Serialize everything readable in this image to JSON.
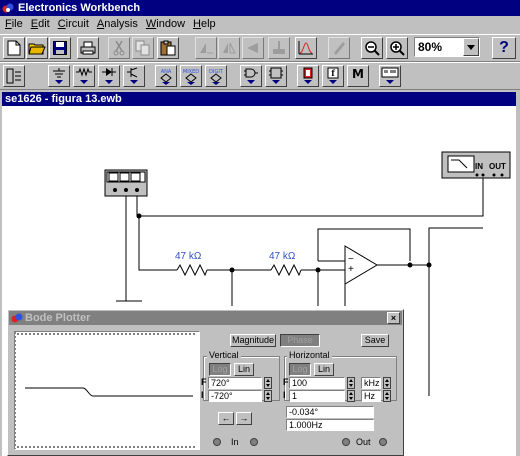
{
  "window": {
    "title": "Electronics Workbench"
  },
  "menu": [
    {
      "label": "File",
      "key": "F",
      "rest": "ile"
    },
    {
      "label": "Edit",
      "key": "E",
      "rest": "dit"
    },
    {
      "label": "Circuit",
      "key": "C",
      "rest": "ircuit"
    },
    {
      "label": "Analysis",
      "key": "A",
      "rest": "nalysis"
    },
    {
      "label": "Window",
      "key": "W",
      "rest": "indow"
    },
    {
      "label": "Help",
      "key": "H",
      "rest": "elp"
    }
  ],
  "toolbar": {
    "zoom_value": "80%",
    "help_label": "?",
    "parts_bin_labels": {
      "analog": "ANA",
      "mixed": "MIXED",
      "digital": "DIGIT"
    },
    "function_label": "f",
    "misc_label": "M"
  },
  "document": {
    "title": "se1626 - figura 13.ewb"
  },
  "circuit": {
    "r1_label": "47 kΩ",
    "r2_label": "47 kΩ",
    "filter_in": "IN",
    "filter_out": "OUT",
    "opamp_minus": "−",
    "opamp_plus": "+"
  },
  "bode": {
    "title": "Bode Plotter",
    "close_label": "×",
    "magnitude_label": "Magnitude",
    "phase_label": "Phase",
    "save_label": "Save",
    "vertical_label": "Vertical",
    "horizontal_label": "Horizontal",
    "log_label": "Log",
    "lin_label": "Lin",
    "v_final_value": "720°",
    "v_initial_value": "-720°",
    "h_final_value": "100",
    "h_final_unit": "kHz",
    "h_initial_value": "1",
    "h_initial_unit": "Hz",
    "f_label": "F",
    "i_label": "I",
    "left_arrow": "←",
    "right_arrow": "→",
    "readout_phase": "-0.034°",
    "readout_freq": "1.000Hz",
    "in_label": "In",
    "out_label": "Out"
  }
}
